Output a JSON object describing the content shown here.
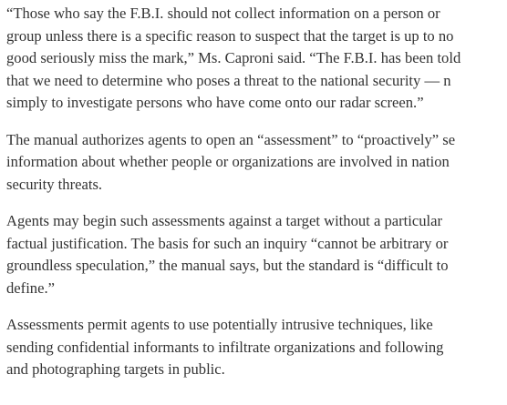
{
  "article": {
    "paragraphs": [
      {
        "lines": [
          "“Those who say the F.B.I. should not collect information on a person or",
          "group unless there is a specific reason to suspect that the target is up to no",
          "good seriously miss the mark,” Ms. Caproni said. “The F.B.I. has been told",
          "that we need to determine who poses a threat to the national security — n",
          "simply to investigate persons who have come onto our radar screen.”"
        ]
      },
      {
        "lines": [
          "The manual authorizes agents to open an “assessment” to “proactively” se",
          "information about whether people or organizations are involved in nation",
          "security threats."
        ]
      },
      {
        "lines": [
          "Agents may begin such assessments against a target without a particular",
          "factual justification. The basis for such an inquiry “cannot be arbitrary or",
          "groundless speculation,” the manual says, but the standard is “difficult to",
          "define.”"
        ]
      },
      {
        "lines": [
          "Assessments permit agents to use potentially intrusive techniques, like",
          "sending confidential informants to infiltrate organizations and following",
          "and photographing targets in public."
        ]
      }
    ]
  }
}
